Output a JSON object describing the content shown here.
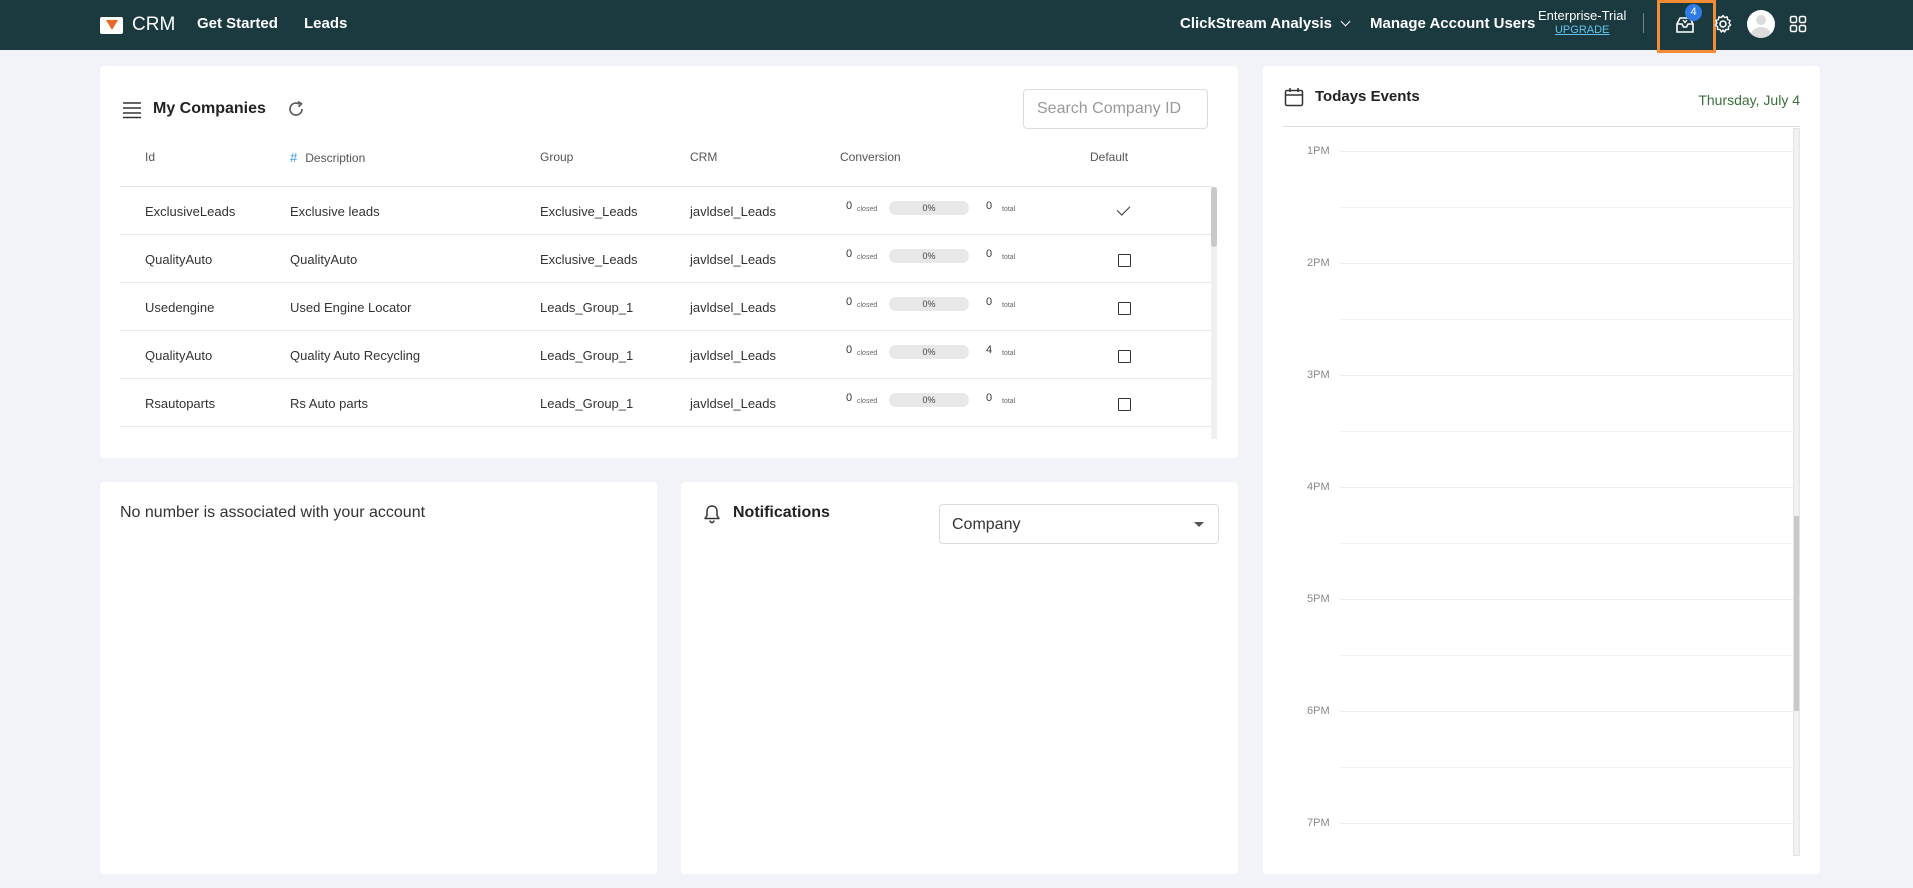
{
  "topbar": {
    "brand": "CRM",
    "nav": [
      {
        "label": "Get Started"
      },
      {
        "label": "Leads"
      }
    ],
    "workspace": "ClickStream Analysis",
    "manage_users": "Manage Account Users",
    "plan": "Enterprise-Trial",
    "upgrade": "UPGRADE",
    "inbox_count": "4",
    "icons": [
      "inbox-icon",
      "gear-icon",
      "avatar",
      "apps-grid-icon"
    ],
    "bg_color": "#1b3a3f",
    "highlight_color": "#f28d35"
  },
  "companies": {
    "title": "My Companies",
    "search_placeholder": "Search Company ID",
    "columns": {
      "id": "Id",
      "hash": "#",
      "description": "Description",
      "group": "Group",
      "crm": "CRM",
      "conversion": "Conversion",
      "default": "Default"
    },
    "closed_label": "closed",
    "total_label": "total",
    "rows": [
      {
        "id": "ExclusiveLeads",
        "description": "Exclusive leads",
        "group": "Exclusive_Leads",
        "crm": "javldsel_Leads",
        "closed": "0",
        "pct": "0%",
        "total": "0",
        "default": true
      },
      {
        "id": "QualityAuto",
        "description": "QualityAuto",
        "group": "Exclusive_Leads",
        "crm": "javldsel_Leads",
        "closed": "0",
        "pct": "0%",
        "total": "0",
        "default": false
      },
      {
        "id": "Usedengine",
        "description": "Used Engine Locator",
        "group": "Leads_Group_1",
        "crm": "javldsel_Leads",
        "closed": "0",
        "pct": "0%",
        "total": "0",
        "default": false
      },
      {
        "id": "QualityAuto",
        "description": "Quality Auto Recycling",
        "group": "Leads_Group_1",
        "crm": "javldsel_Leads",
        "closed": "0",
        "pct": "0%",
        "total": "4",
        "default": false
      },
      {
        "id": "Rsautoparts",
        "description": "Rs Auto parts",
        "group": "Leads_Group_1",
        "crm": "javldsel_Leads",
        "closed": "0",
        "pct": "0%",
        "total": "0",
        "default": false
      }
    ]
  },
  "calls": {
    "message": "No number is associated with your account"
  },
  "notifications": {
    "title": "Notifications",
    "filter_value": "Company"
  },
  "events": {
    "title": "Todays Events",
    "date": "Thursday, July 4",
    "hours": [
      "1PM",
      "2PM",
      "3PM",
      "4PM",
      "5PM",
      "6PM",
      "7PM"
    ]
  }
}
